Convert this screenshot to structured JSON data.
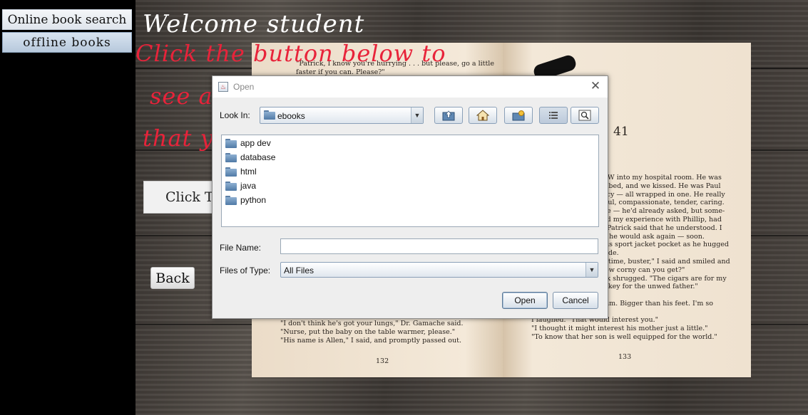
{
  "nav": {
    "online_label": "Online book search",
    "offline_label": "offline  books"
  },
  "main": {
    "welcome": "Welcome student",
    "line1": "Click the button below to",
    "line2": "see av",
    "line3": "that y",
    "click_button": "Click To",
    "back_button": "Back"
  },
  "book": {
    "left_page_top": "\"Patrick, I know you're hurrying . . . but please, go a little\nfaster if you can. Please?\"",
    "left_page_bottom": "\"I don't think he's got your lungs,\" Dr. Gamache said.\n\"Nurse, put the baby on the table warmer, please.\"\n\"His name is Allen,\" I said, and promptly passed out.",
    "left_page_number": "132",
    "right_chapter": "41",
    "right_page_text": "EW into my hospital room. He was\ny bed, and we kissed. He was Paul\nacy — all wrapped in one. He really\ntful, compassionate, tender, caring.\nne — he'd already asked, but some-\nad my experience with Phillip, had\n. Patrick said that he understood. I\nd he would ask again — soon.\nhis sport jacket pocket as he hugged\nside.\ns time, buster,\" I said and smiled and\nlow corny can you get?\"\nck shrugged. \"The cigars are for my\niskey for the unwed father.\"\n\"\nhim. Bigger than his feet. I'm so",
    "right_page_bottom": "I laughed. \"That would interest you.\"\n\"I thought it might interest his mother just a little.\"\n\"To know that her son is well equipped for the world.\"",
    "right_page_number": "133"
  },
  "dialog": {
    "title": "Open",
    "look_in_label": "Look In:",
    "look_in_value": "ebooks",
    "files": [
      {
        "name": "app dev"
      },
      {
        "name": "database"
      },
      {
        "name": "html"
      },
      {
        "name": "java"
      },
      {
        "name": "python"
      }
    ],
    "file_name_label": "File Name:",
    "file_name_value": "",
    "files_of_type_label": "Files of Type:",
    "files_of_type_value": "All Files",
    "open_button": "Open",
    "cancel_button": "Cancel",
    "toolbar_icons": [
      "up-one-level-icon",
      "home-icon",
      "new-folder-icon",
      "list-view-icon",
      "details-view-icon"
    ]
  }
}
